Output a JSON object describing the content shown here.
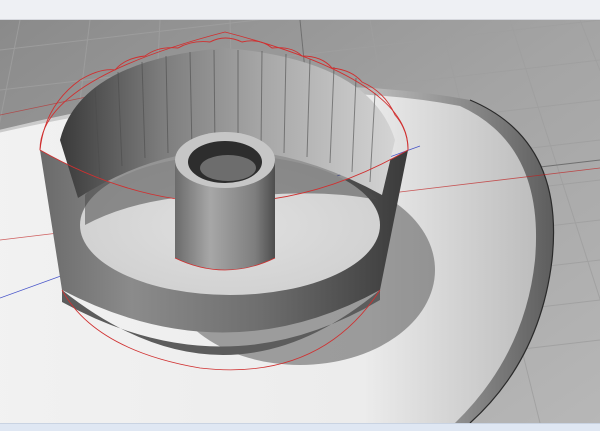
{
  "viewport": {
    "display_mode": "shaded",
    "grid": "on",
    "colors": {
      "background": "#8e8e8e",
      "grid_line": "#9c9c9c",
      "grid_major": "#7a7a7a",
      "plate": "#e6e6e6",
      "object_body": "#8a8a8a",
      "edge_highlight": "#d03030",
      "axis_x": "#c02020",
      "axis_y": "#2030c0"
    }
  }
}
